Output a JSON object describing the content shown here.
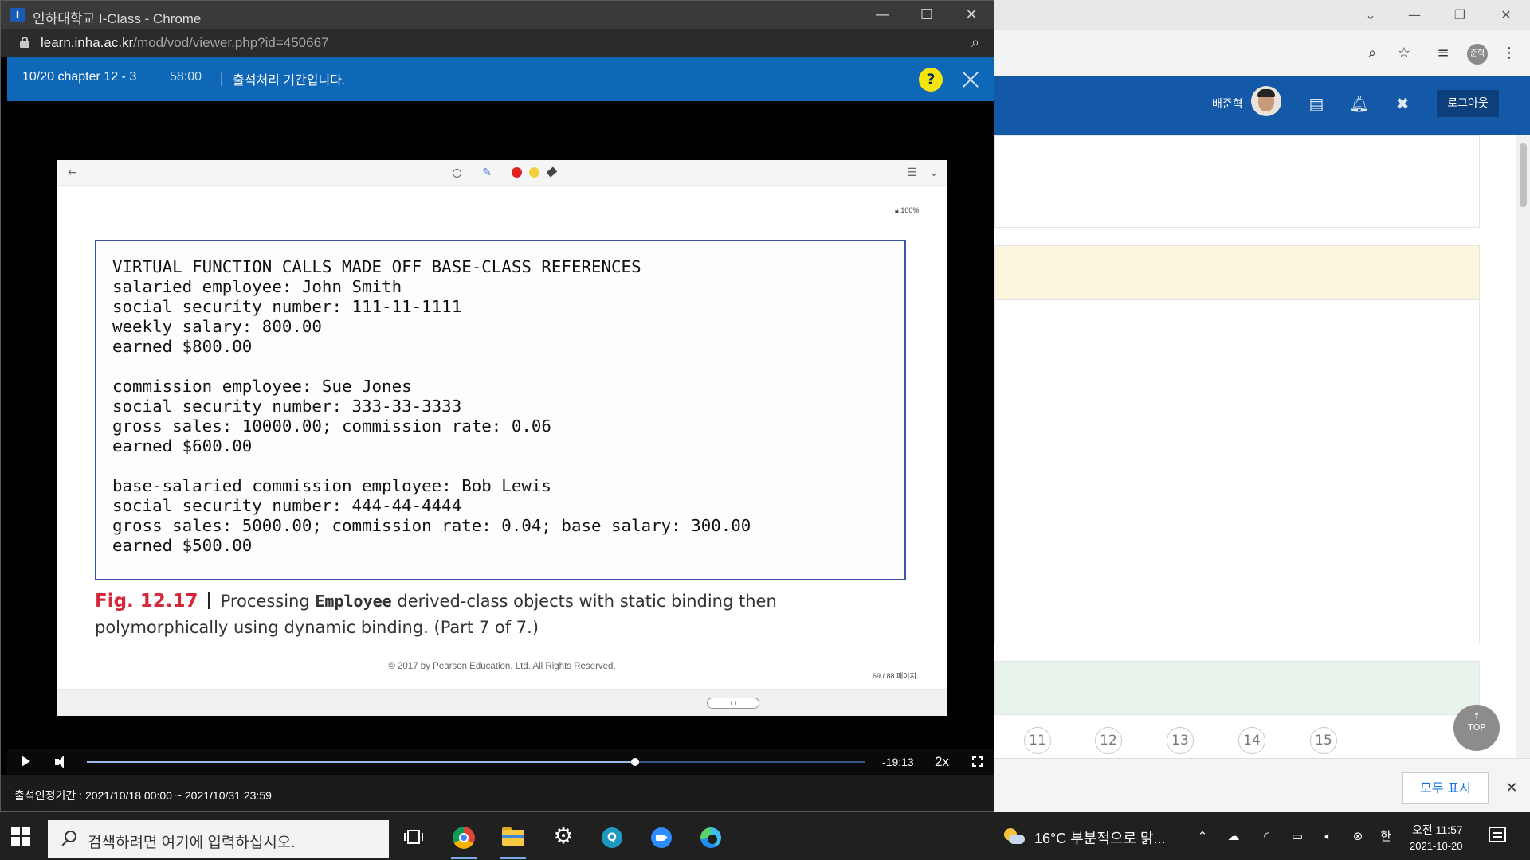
{
  "background_browser": {
    "username": "배준혁",
    "avatar_initials": "준혁",
    "logout_label": "로그아웃",
    "page_numbers": [
      "11",
      "12",
      "13",
      "14",
      "15"
    ],
    "top_label": "TOP",
    "show_all_label": "모두 표시"
  },
  "popup": {
    "window_title": "인하대학교 I-Class - Chrome",
    "url_host": "learn.inha.ac.kr",
    "url_path": "/mod/vod/viewer.php?id=450667"
  },
  "player": {
    "lecture_title": "10/20 chapter 12 - 3",
    "duration": "58:00",
    "attendance_message": "출석처리 기간입니다.",
    "help_label": "?",
    "time_remaining": "-19:13",
    "speed_label": "2x",
    "progress_fraction": 0.705,
    "attendance_period": "출석인정기간 : 2021/10/18 00:00 ~ 2021/10/31 23:59"
  },
  "slide": {
    "zoom_label": "100%",
    "code_lines": [
      "VIRTUAL FUNCTION CALLS MADE OFF BASE-CLASS REFERENCES",
      "salaried employee: John Smith",
      "social security number: 111-11-1111",
      "weekly salary: 800.00",
      "earned $800.00",
      "",
      "commission employee: Sue Jones",
      "social security number: 333-33-3333",
      "gross sales: 10000.00; commission rate: 0.06",
      "earned $600.00",
      "",
      "base-salaried commission employee: Bob Lewis",
      "social security number: 444-44-4444",
      "gross sales: 5000.00; commission rate: 0.04; base salary: 300.00",
      "earned $500.00"
    ],
    "figure_label": "Fig. 12.17",
    "caption_before": "Processing ",
    "caption_code_word": "Employee",
    "caption_after": " derived-class objects with static binding then polymorphically using dynamic binding. (Part 7 of 7.)",
    "copyright": "© 2017 by Pearson Education, Ltd. All Rights Reserved.",
    "page_indicator": "69 / 88 페이지"
  },
  "taskbar": {
    "search_placeholder": "검색하려면 여기에 입력하십시오.",
    "weather": "16°C  부분적으로 맑...",
    "ime_label": "한",
    "clock_time": "오전 11:57",
    "clock_date": "2021-10-20"
  }
}
